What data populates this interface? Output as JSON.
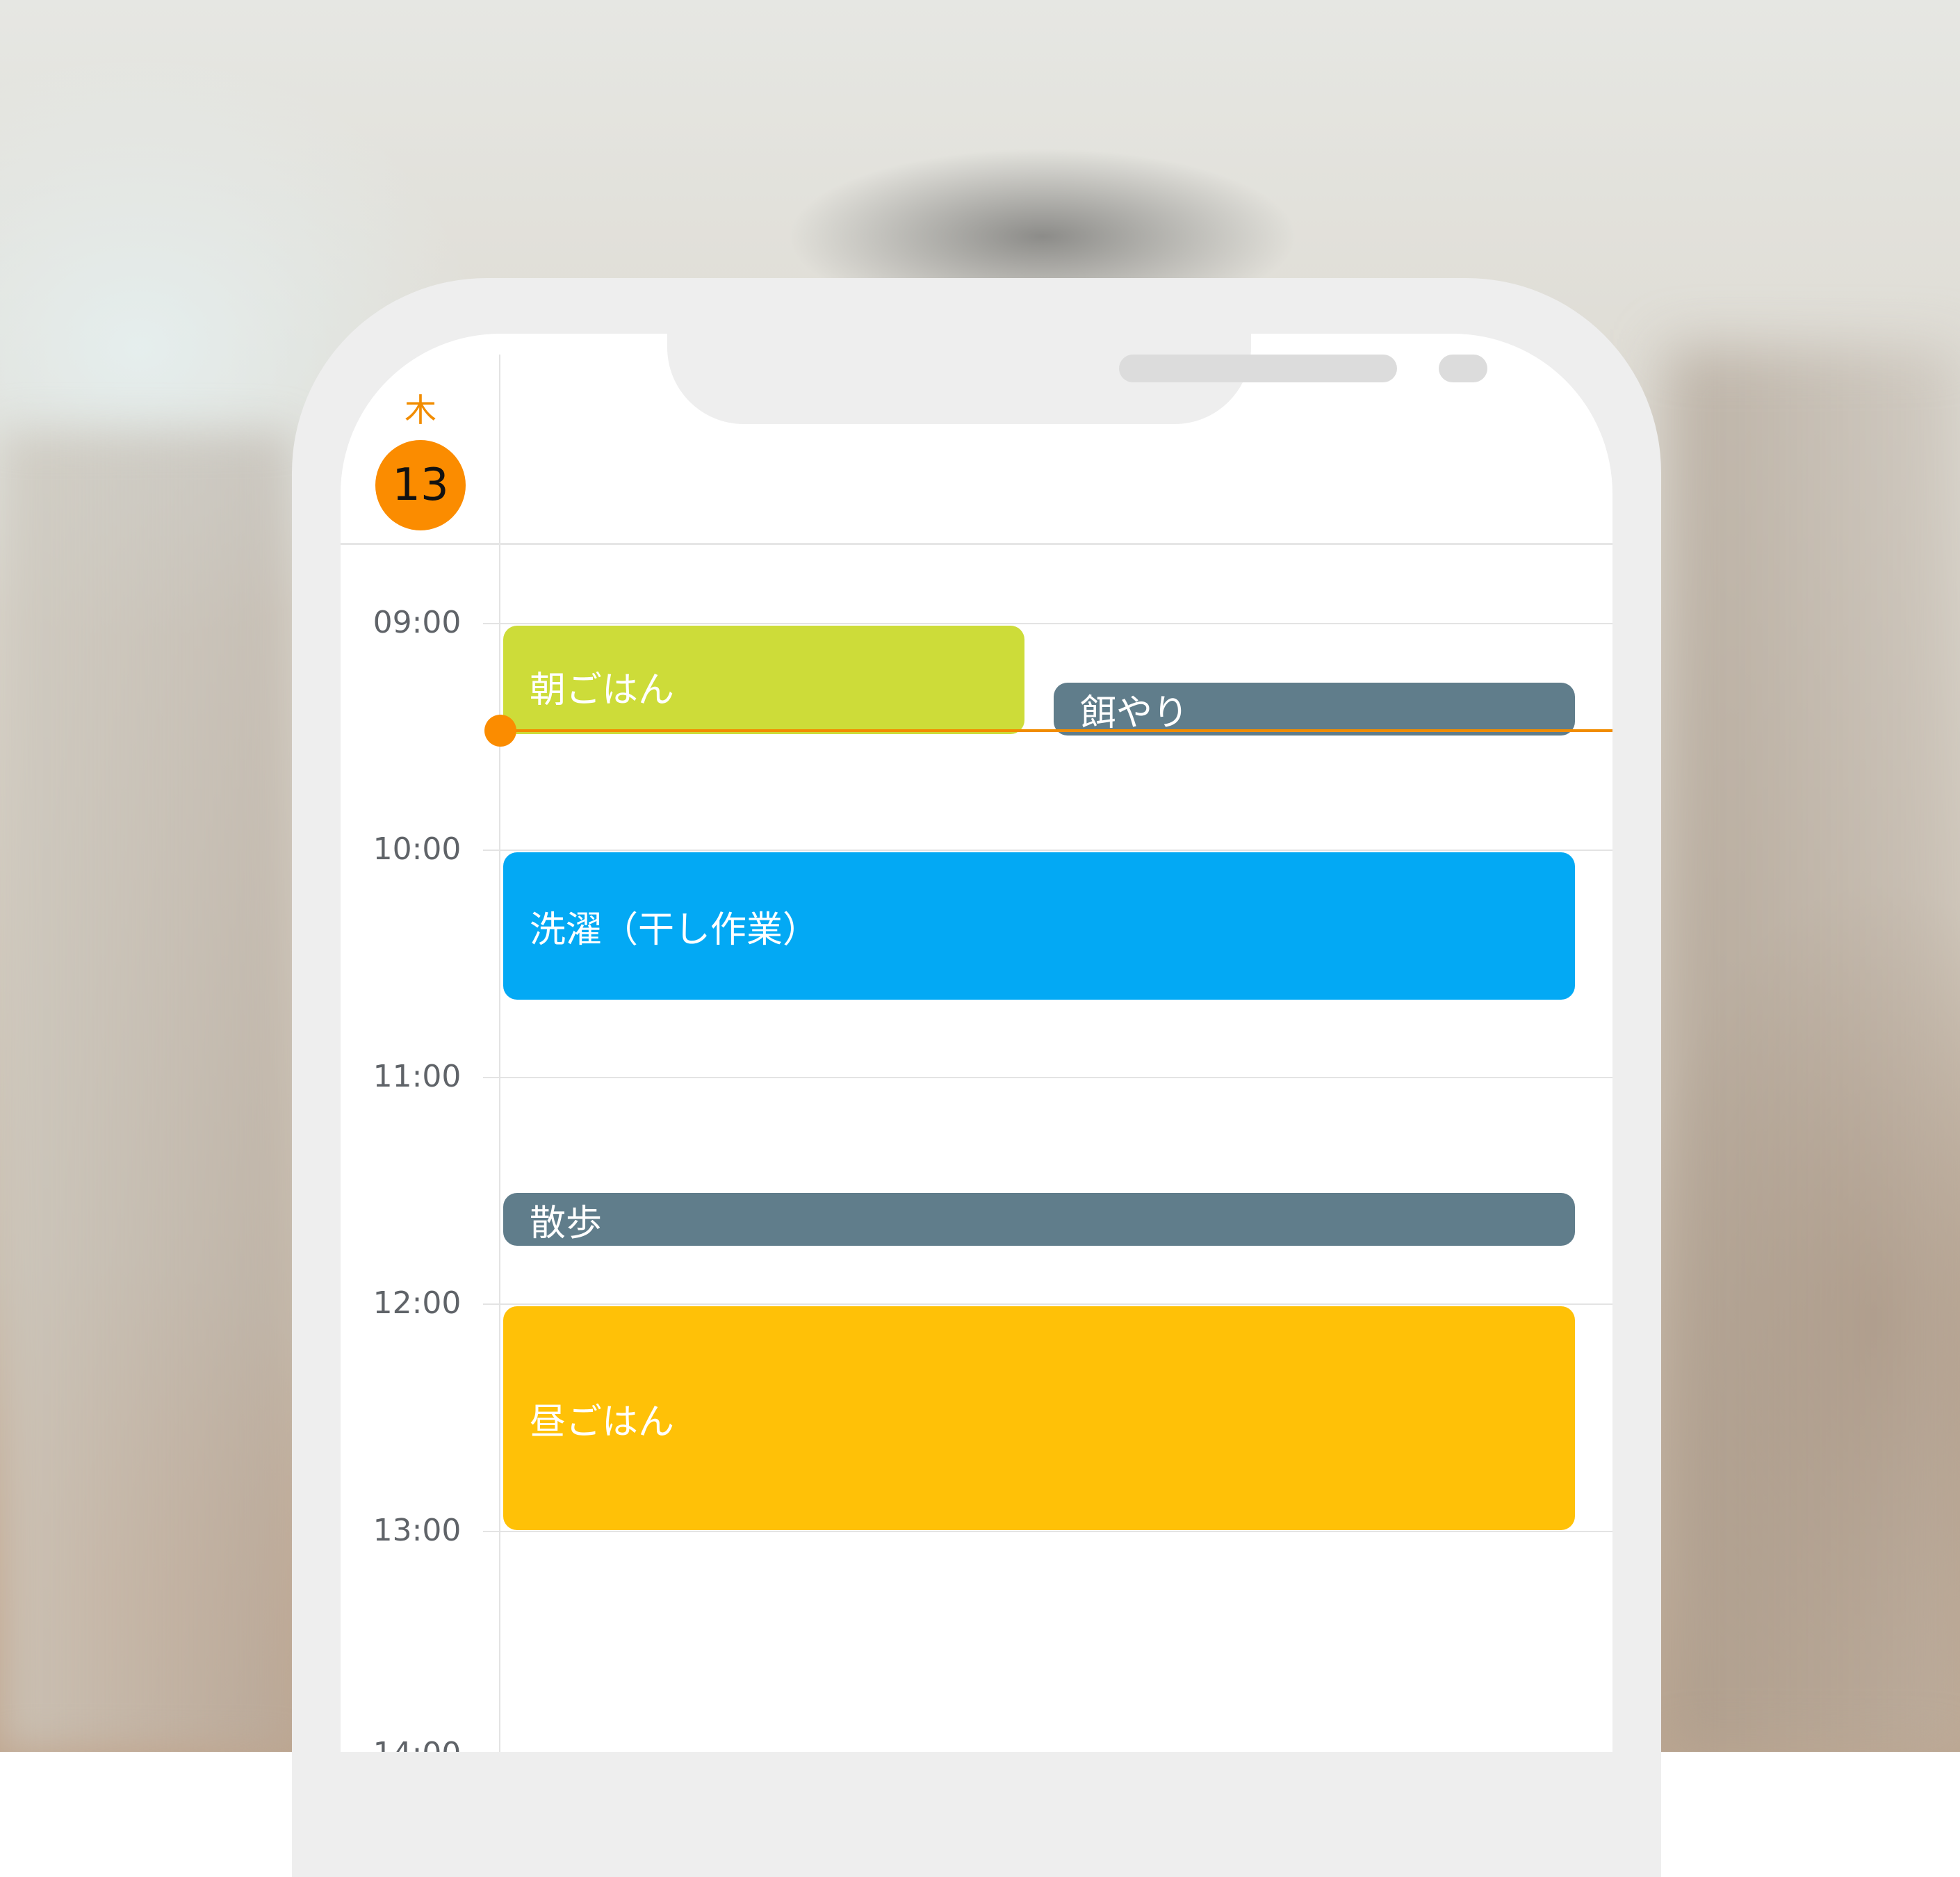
{
  "calendar": {
    "day_of_week": "木",
    "date": "13",
    "hours": [
      "09:00",
      "10:00",
      "11:00",
      "12:00",
      "13:00",
      "14:00"
    ]
  },
  "events": {
    "breakfast": {
      "title": "朝ごはん",
      "color": "#cddc39"
    },
    "feeding": {
      "title": "餌やり",
      "color": "#607d8b"
    },
    "laundry": {
      "title": "洗濯（干し作業）",
      "color": "#03a9f4"
    },
    "walk": {
      "title": "散歩",
      "color": "#607d8b"
    },
    "lunch": {
      "title": "昼ごはん",
      "color": "#ffc107"
    }
  },
  "colors": {
    "accent": "#fb8c00",
    "now_indicator": "#f18c00",
    "phone_frame": "#eeeeee"
  }
}
